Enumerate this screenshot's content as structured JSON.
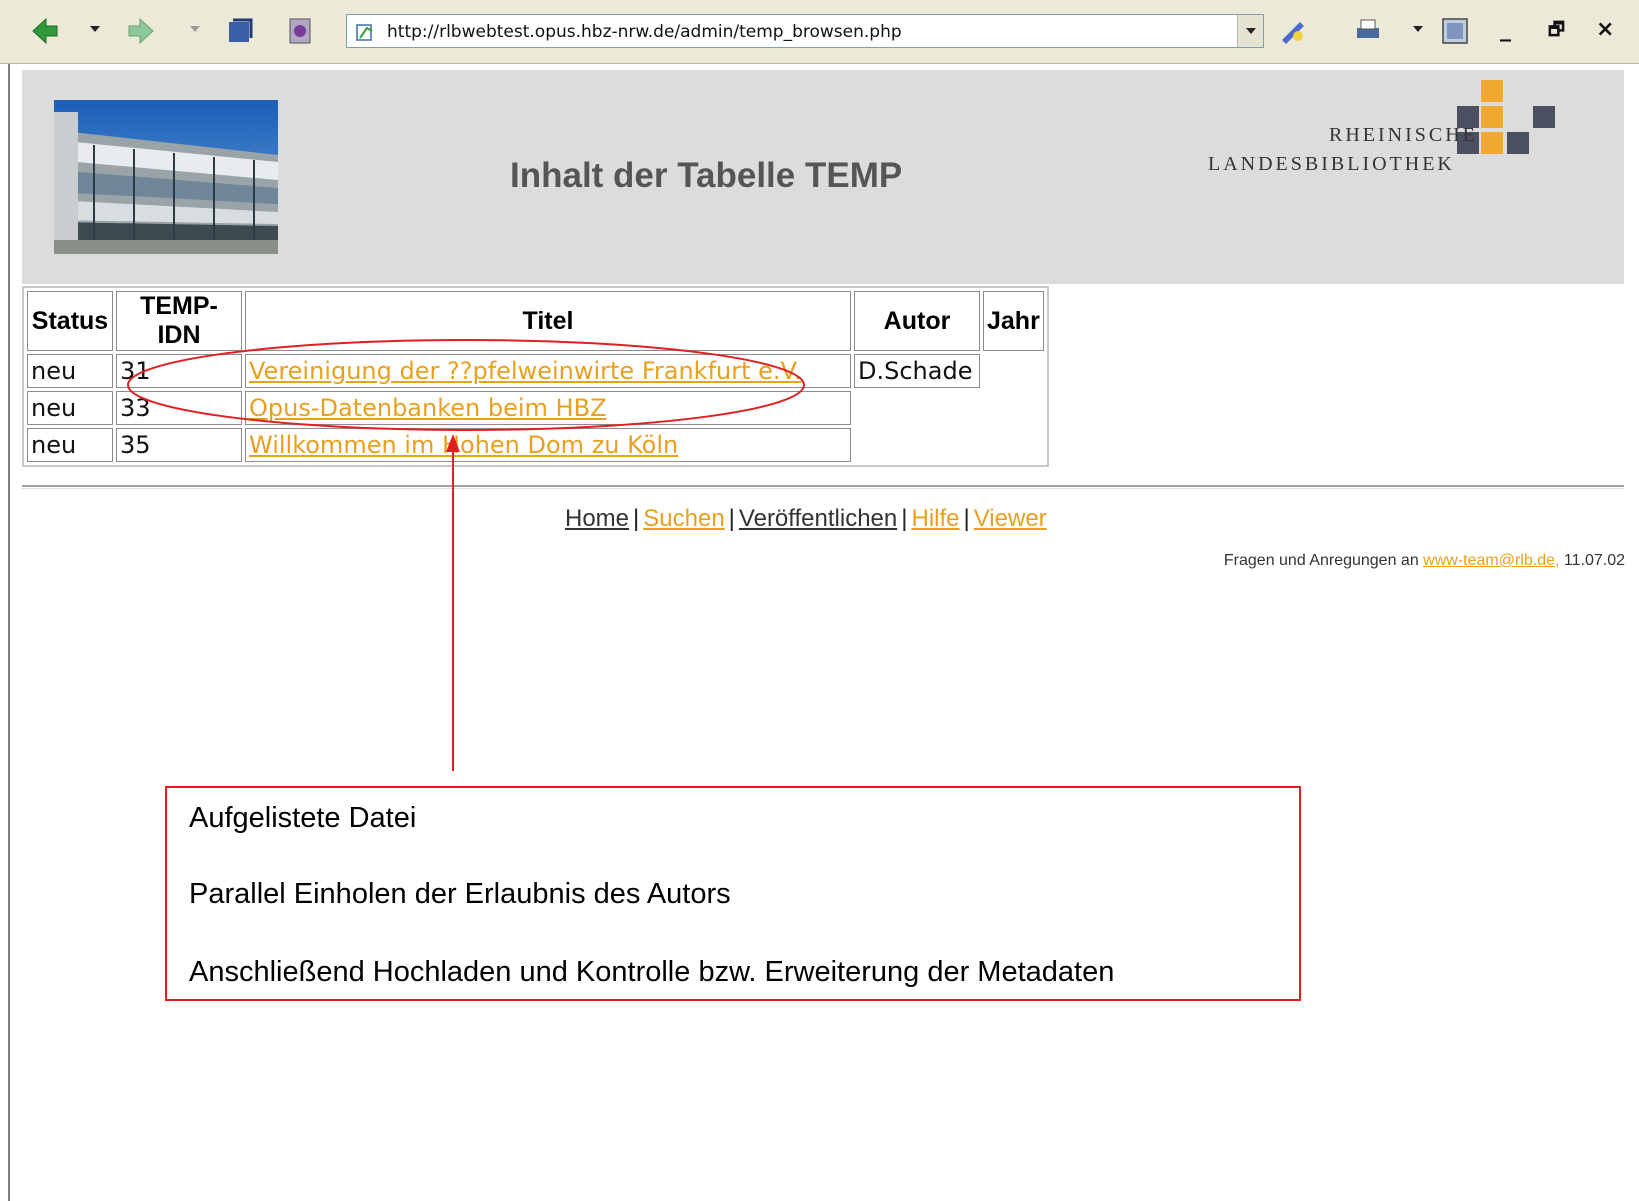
{
  "browser": {
    "address": "http://rlbwebtest.opus.hbz-nrw.de/admin/temp_browsen.php",
    "window_controls": {
      "minimize": "_",
      "restore": "🗗",
      "close": "×"
    }
  },
  "header": {
    "title": "Inhalt der Tabelle TEMP",
    "logo_line1": "RHEINISCHE",
    "logo_line2": "LANDESBIBLIOTHEK"
  },
  "table": {
    "columns": [
      "Status",
      "TEMP-IDN",
      "Titel",
      "Autor",
      "Jahr"
    ],
    "rows": [
      {
        "status": "neu",
        "idn": "31",
        "titel": "Vereinigung der ??pfelweinwirte Frankfurt e.V.",
        "autor": "D.Schade",
        "jahr": ""
      },
      {
        "status": "neu",
        "idn": "33",
        "titel": "Opus-Datenbanken beim HBZ",
        "autor": "",
        "jahr": ""
      },
      {
        "status": "neu",
        "idn": "35",
        "titel": "Willkommen im Hohen Dom zu Köln",
        "autor": "",
        "jahr": ""
      }
    ]
  },
  "nav": {
    "home": "Home",
    "suchen": "Suchen",
    "veroeffentlichen": "Veröffentlichen",
    "hilfe": "Hilfe",
    "viewer": "Viewer",
    "separator": "|"
  },
  "footer": {
    "prefix": "Fragen und Anregungen an",
    "email": "www-team@rlb.de,",
    "date": "11.07.02"
  },
  "annotation": {
    "lines": [
      "Aufgelistete Datei",
      "Parallel Einholen der Erlaubnis des Autors",
      "Anschließend Hochladen und Kontrolle bzw. Erweiterung der Metadaten"
    ],
    "color": "#e02020"
  },
  "colors": {
    "link": "#e8a020",
    "header_bg": "#dcdcdc",
    "logo_orange": "#f0a830",
    "logo_gray": "#4a5060"
  }
}
